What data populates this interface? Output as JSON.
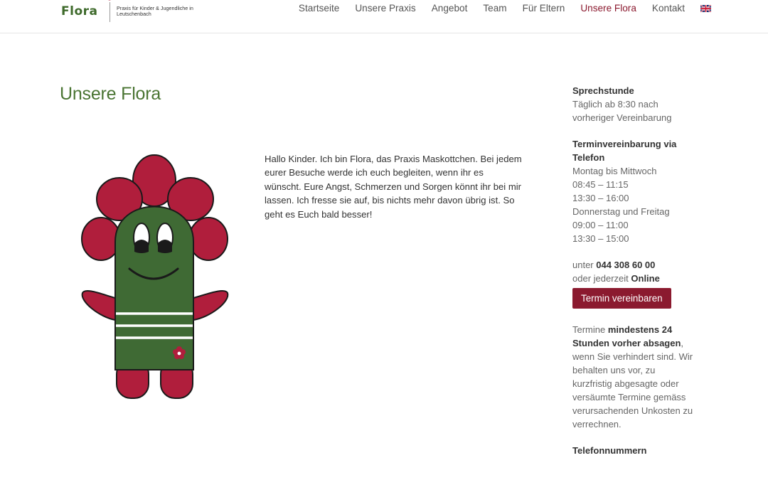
{
  "header": {
    "logo_word": "Flora",
    "logo_tagline": "Praxis für Kinder & Jugendliche in Leutschenbach",
    "nav": [
      {
        "label": "Startseite"
      },
      {
        "label": "Unsere Praxis"
      },
      {
        "label": "Angebot"
      },
      {
        "label": "Team"
      },
      {
        "label": "Für Eltern"
      },
      {
        "label": "Unsere Flora"
      },
      {
        "label": "Kontakt"
      }
    ],
    "active_nav": "Unsere Flora",
    "language_icon": "uk-flag-icon"
  },
  "main": {
    "title": "Unsere Flora",
    "intro": "Hallo Kinder. Ich bin Flora, das Praxis Maskottchen. Bei jedem eurer Besuche werde ich euch begleiten, wenn ihr es wünscht. Eure Angst, Schmerzen und Sorgen könnt ihr bei mir lassen. Ich fresse sie auf, bis nichts mehr davon übrig ist. So geht es Euch bald besser!"
  },
  "sidebar": {
    "sprechstunde_title": "Sprechstunde",
    "sprechstunde_text": "Täglich ab 8:30 nach vorheriger Vereinbarung",
    "termin_title": "Terminvereinbarung via Telefon",
    "days_1": "Montag bis Mittwoch",
    "time_1a": "08:45 – 11:15",
    "time_1b": "13:30 – 16:00",
    "days_2": "Donnerstag und Freitag",
    "time_2a": "09:00 – 11:00",
    "time_2b": "13:30 – 15:00",
    "phone_prefix": "unter ",
    "phone": "044 308 60 00",
    "online_prefix": "oder jederzeit ",
    "online": "Online",
    "button_label": "Termin vereinbaren",
    "cancel_prefix": "Termine ",
    "cancel_strong": "mindestens 24 Stunden vorher absagen",
    "cancel_suffix": ", wenn Sie verhindert sind. Wir behalten uns vor, zu kurzfristig abgesagte oder versäumte Termine gemäss verursachenden Unkosten zu verrechnen.",
    "phones_title": "Telefonnummern"
  },
  "colors": {
    "brand_green": "#4a7533",
    "accent_red": "#8b1a2f",
    "mascot_petal": "#b01e3c",
    "mascot_body": "#3f6a34"
  }
}
